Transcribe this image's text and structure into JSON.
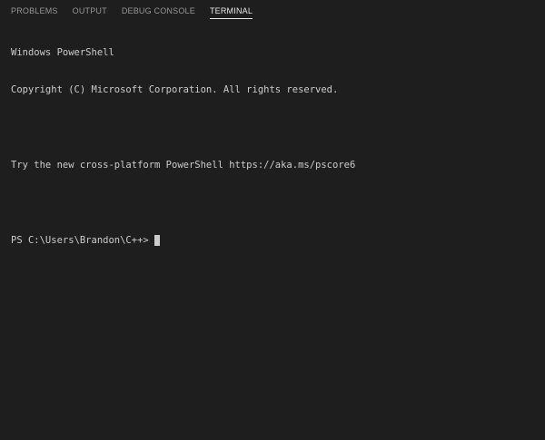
{
  "tabs": [
    {
      "label": "PROBLEMS",
      "active": false
    },
    {
      "label": "OUTPUT",
      "active": false
    },
    {
      "label": "DEBUG CONSOLE",
      "active": false
    },
    {
      "label": "TERMINAL",
      "active": true
    }
  ],
  "terminal": {
    "lines": [
      "Windows PowerShell",
      "Copyright (C) Microsoft Corporation. All rights reserved.",
      "",
      "Try the new cross-platform PowerShell https://aka.ms/pscore6",
      ""
    ],
    "prompt": "PS C:\\Users\\Brandon\\C++> "
  },
  "colors": {
    "background": "#1e1e1e",
    "tab_inactive": "#969696",
    "tab_active": "#e7e7e7",
    "text": "#cccccc"
  }
}
